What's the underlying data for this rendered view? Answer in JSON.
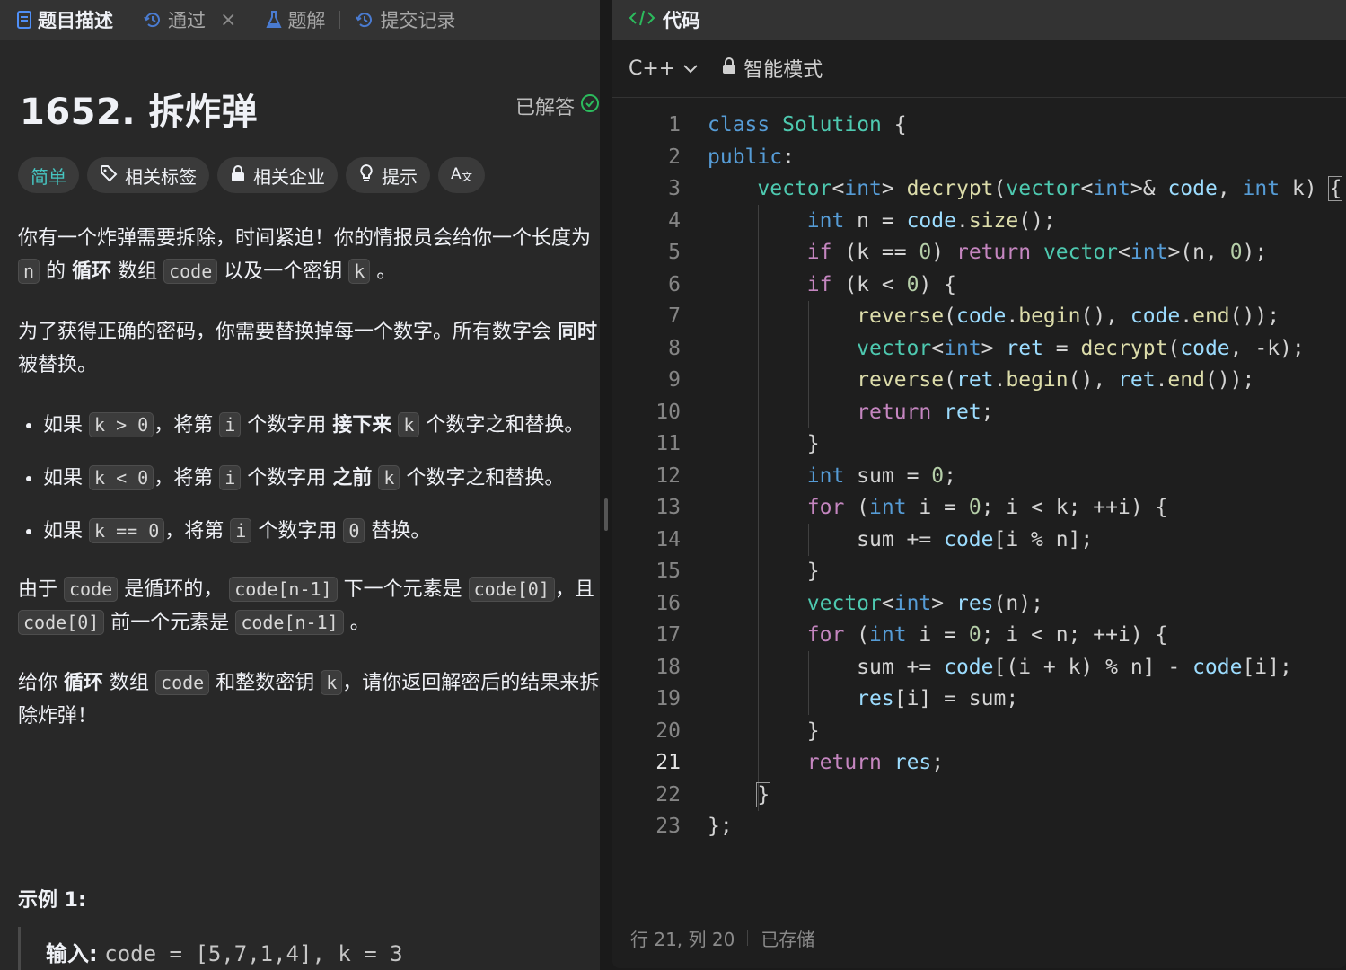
{
  "left_tabs": [
    {
      "label": "题目描述",
      "active": true
    },
    {
      "label": "通过",
      "active": false
    },
    {
      "label": "题解",
      "active": false
    },
    {
      "label": "提交记录",
      "active": false
    }
  ],
  "problem": {
    "title": "1652. 拆炸弹",
    "status": "已解答",
    "tags": [
      "简单",
      "相关标签",
      "相关企业",
      "提示"
    ],
    "description": {
      "p1": [
        "你有一个炸弹需要拆除，时间紧迫！你的情报员会给你一个长度为",
        "n",
        "的",
        "循环",
        "数组",
        "code",
        "以及一个密钥",
        "k",
        "。"
      ],
      "p2": [
        "为了获得正确的密码，你需要替换掉每一个数字。所有数字会",
        "同时",
        "被替换。"
      ],
      "bullets": [
        [
          "如果",
          "k > 0",
          "，将第",
          "i",
          "个数字用",
          "接下来",
          "k",
          "个数字之和替换。"
        ],
        [
          "如果",
          "k < 0",
          "，将第",
          "i",
          "个数字用",
          "之前",
          "k",
          "个数字之和替换。"
        ],
        [
          "如果",
          "k == 0",
          "，将第",
          "i",
          "个数字用",
          "0",
          "替换。"
        ]
      ],
      "p3": [
        "由于",
        "code",
        "是循环的，",
        "code[n-1]",
        "下一个元素是",
        "code[0]",
        "，且",
        "code[0]",
        "前一个元素是",
        "code[n-1]",
        "。"
      ],
      "p4": [
        "给你",
        "循环",
        "数组",
        "code",
        "和整数密钥",
        "k",
        "，请你返回解密后的结果来拆除炸弹！"
      ]
    },
    "example_title": "示例 1:",
    "example_input_label": "输入:",
    "example_input": "code = [5,7,1,4], k = 3"
  },
  "editor": {
    "tab_label": "代码",
    "language": "C++",
    "mode": "智能模式",
    "active_line": 21,
    "status_pos": "行 21, 列 20",
    "status_saved": "已存储",
    "code_lines": [
      "class Solution {",
      "public:",
      "    vector<int> decrypt(vector<int>& code, int k) {",
      "        int n = code.size();",
      "        if (k == 0) return vector<int>(n, 0);",
      "        if (k < 0) {",
      "            reverse(code.begin(), code.end());",
      "            vector<int> ret = decrypt(code, -k);",
      "            reverse(ret.begin(), ret.end());",
      "            return ret;",
      "        }",
      "        int sum = 0;",
      "        for (int i = 0; i < k; ++i) {",
      "            sum += code[i % n];",
      "        }",
      "        vector<int> res(n);",
      "        for (int i = 0; i < n; ++i) {",
      "            sum += code[(i + k) % n] - code[i];",
      "            res[i] = sum;",
      "        }",
      "        return res;",
      "    }",
      "};"
    ]
  },
  "colors": {
    "easy": "#46c6c2",
    "solved_check": "#2cbb5d",
    "keyword": "#569cd6",
    "type": "#4ec9b0",
    "function": "#dcdcaa",
    "variable": "#9cdcfe",
    "number": "#b5cea8",
    "control": "#c586c0"
  }
}
